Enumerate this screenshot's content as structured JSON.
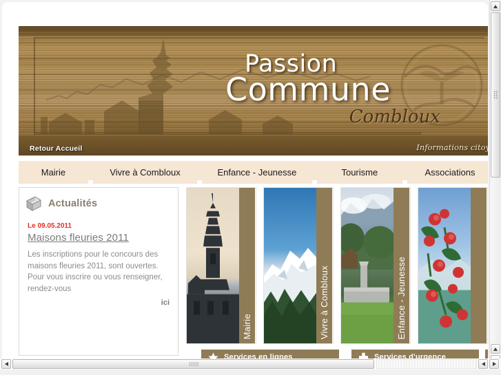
{
  "site": {
    "logo_line1": "Passion",
    "logo_line2": "Commune",
    "logo_line3": "Combloux",
    "home_link": "Retour Accueil",
    "tagline": "Informations citoy"
  },
  "nav": {
    "items": [
      {
        "label": "Mairie"
      },
      {
        "label": "Vivre à Combloux"
      },
      {
        "label": "Enfance - Jeunesse"
      },
      {
        "label": "Tourisme"
      },
      {
        "label": "Associations"
      }
    ]
  },
  "news": {
    "icon": "newspaper-icon",
    "title": "Actualités",
    "date": "Le 09.05.2011",
    "headline": "Maisons fleuries 2011",
    "body": "Les inscriptions pour le concours des maisons fleuries 2011, sont ouvertes. Pour vous inscrire ou vous renseigner, rendez-vous",
    "more_link": "ici"
  },
  "photo_panels": [
    {
      "label": "Mairie",
      "image": "church-steeple-photo"
    },
    {
      "label": "Vivre à Combloux",
      "image": "mont-blanc-photo"
    },
    {
      "label": "Enfance - Jeunesse",
      "image": "fountain-park-photo"
    },
    {
      "label": "",
      "image": "flowers-lake-photo"
    }
  ],
  "services": [
    {
      "label": "Services en lignes",
      "icon": "star-icon"
    },
    {
      "label": "Services d'urgence",
      "icon": "medical-cross-icon"
    },
    {
      "label": "",
      "icon": "tools-wrench-icon"
    }
  ],
  "colors": {
    "wood_dark": "#6d5329",
    "wood_light": "#b39261",
    "nav_background": "#f6e6d4",
    "label_brown": "#8f7c56",
    "date_red": "#e03128",
    "text_gray": "#8b8b8b"
  },
  "scrollbars": {
    "vertical_up": "▲",
    "vertical_down": "▼",
    "horizontal_left": "◀",
    "horizontal_right": "▶"
  }
}
